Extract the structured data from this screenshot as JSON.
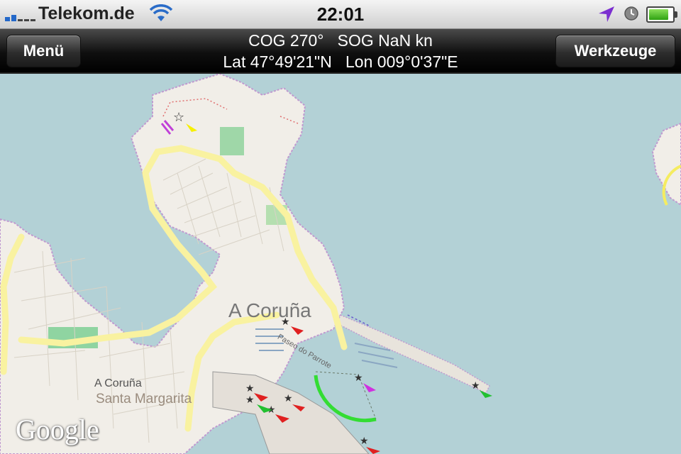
{
  "status_bar": {
    "carrier": "Telekom.de",
    "time": "22:01",
    "icons": [
      "signal-bars-icon",
      "wifi-icon",
      "location-arrow-icon",
      "alarm-clock-icon",
      "battery-icon"
    ],
    "battery_level": 0.85,
    "signal_bars": 2
  },
  "nav_bar": {
    "left_button": "Menü",
    "right_button": "Werkzeuge",
    "line1_cog": "COG 270°",
    "line1_sog": "SOG NaN kn",
    "line2_lat": "Lat 47°49'21\"N",
    "line2_lon": "Lon 009°0'37\"E"
  },
  "map": {
    "city_label": "A Coruña",
    "small_label": "A Coruña",
    "district_label": "Santa Margarita",
    "street_label": "Paseo do Parrote",
    "attribution": "Google",
    "colors": {
      "water": "#b3d1d6",
      "land": "#f1eee8",
      "major_road": "#f9f2a0",
      "park": "#8fd4a1",
      "admin_border": "#b78cc7"
    },
    "markers": [
      "star-marker-icon",
      "ship-marker-icon"
    ]
  }
}
